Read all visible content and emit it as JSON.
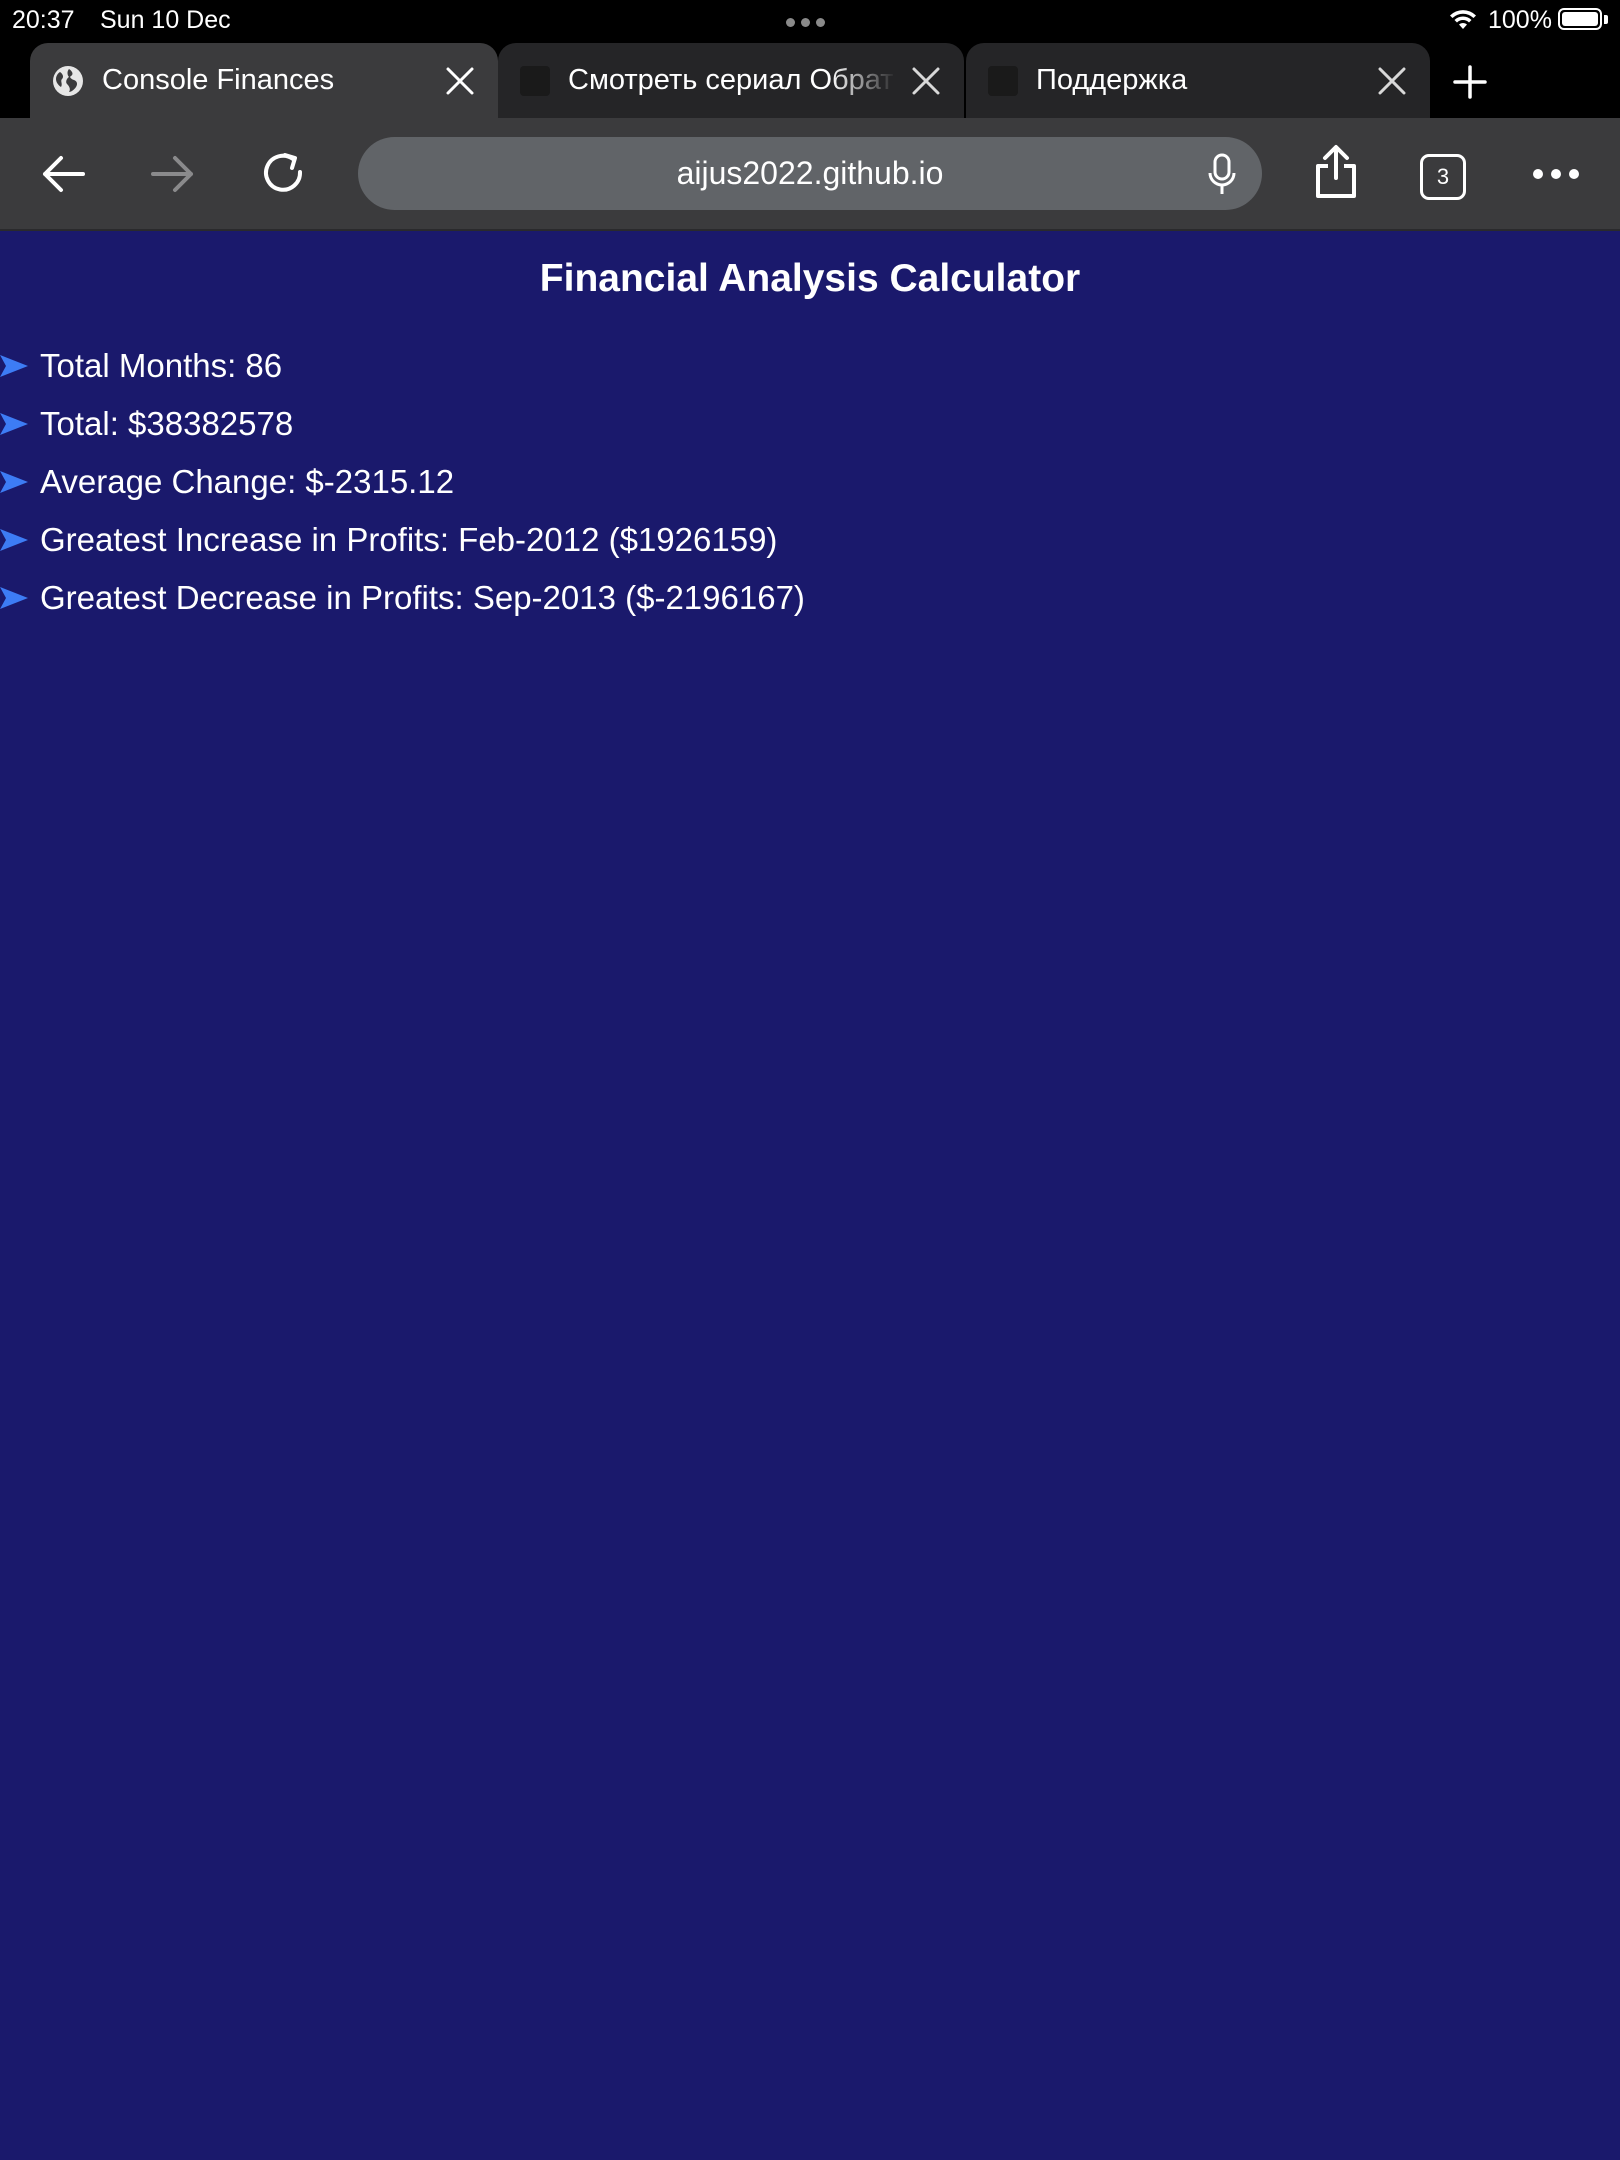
{
  "status_bar": {
    "time": "20:37",
    "date": "Sun 10 Dec",
    "battery": "100%"
  },
  "tabs": [
    {
      "title": "Console Finances",
      "active": true
    },
    {
      "title": "Смотреть сериал Обратный",
      "active": false
    },
    {
      "title": "Поддержка",
      "active": false
    }
  ],
  "toolbar": {
    "url": "aijus2022.github.io",
    "tab_count": "3"
  },
  "page": {
    "title": "Financial Analysis Calculator",
    "results": [
      "Total Months: 86",
      "Total: $38382578",
      "Average Change: $-2315.12",
      "Greatest Increase in Profits: Feb-2012 ($1926159)",
      "Greatest Decrease in Profits: Sep-2013 ($-2196167)"
    ]
  },
  "colors": {
    "page_background": "#1a196c",
    "bullet": "#3d7cf5",
    "toolbar": "#3b3b3d"
  }
}
